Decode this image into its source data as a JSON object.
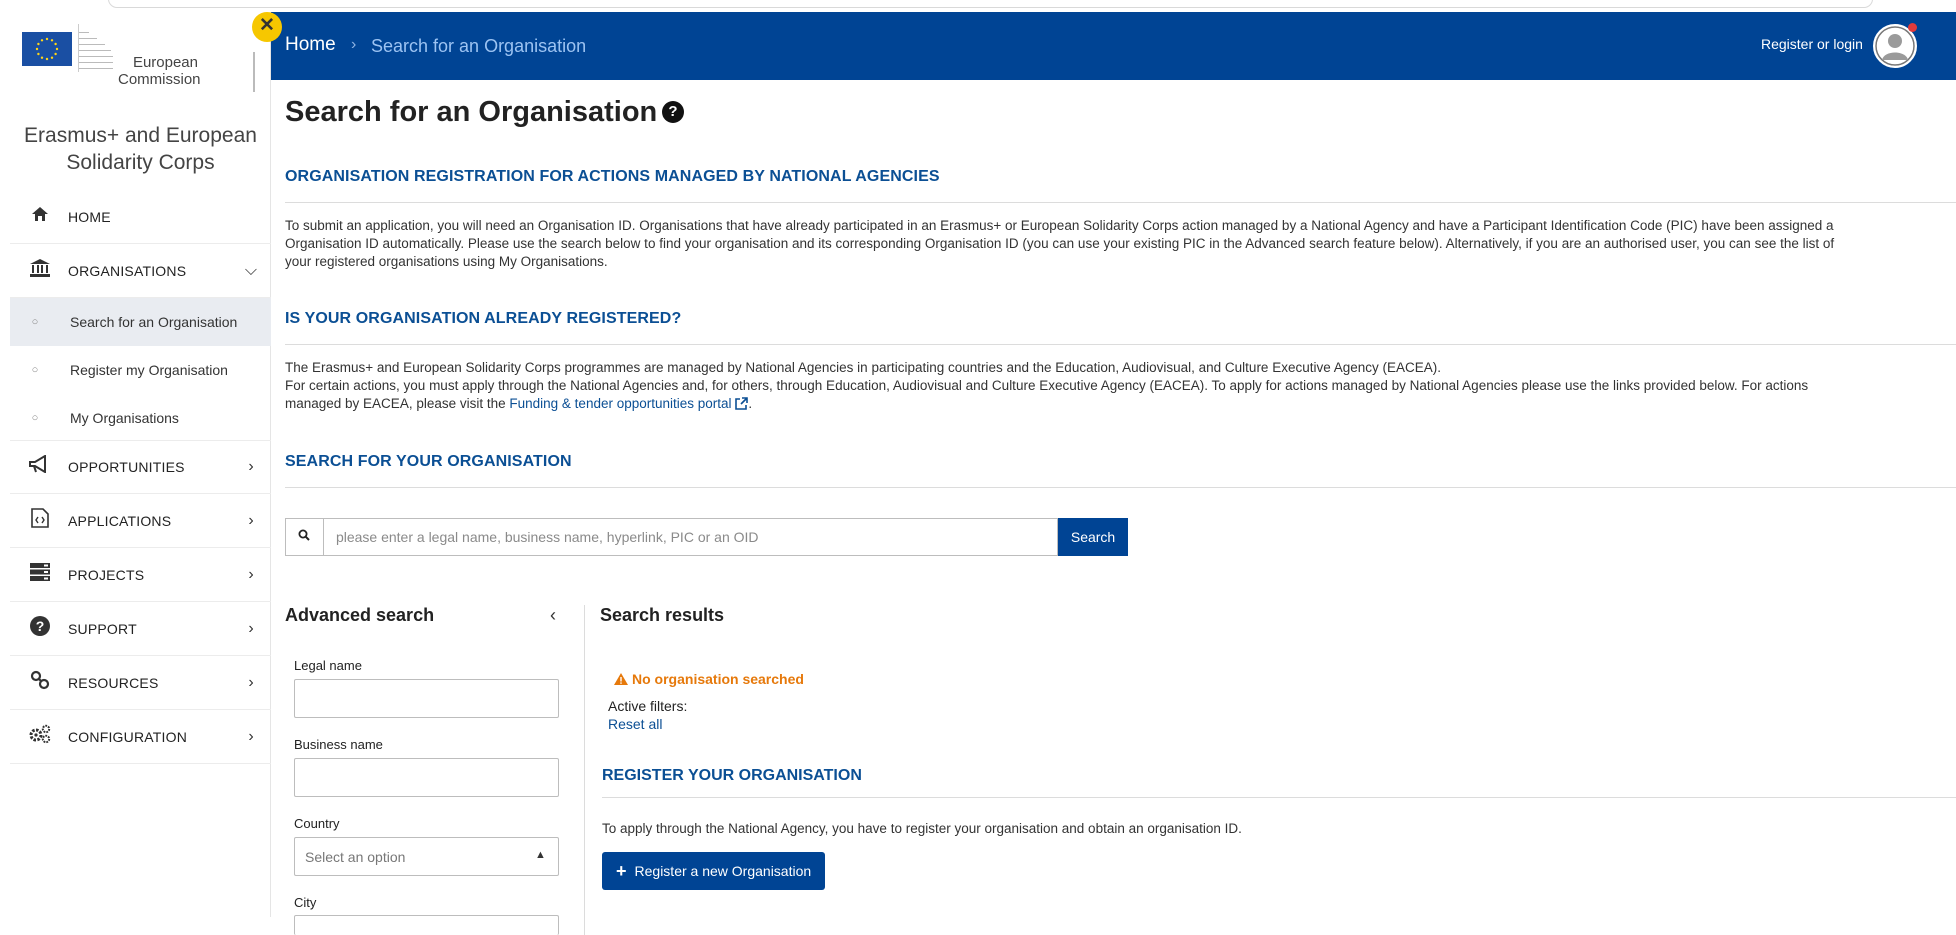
{
  "header": {
    "home": "Home",
    "separator": "›",
    "current": "Search for an Organisation",
    "login": "Register or login"
  },
  "logo": {
    "line1": "European",
    "line2": "Commission"
  },
  "brand": {
    "line1": "Erasmus+ and European",
    "line2": "Solidarity Corps"
  },
  "sidebar": {
    "items": [
      {
        "label": "HOME",
        "icon": "home-icon"
      },
      {
        "label": "ORGANISATIONS",
        "icon": "institution-icon"
      },
      {
        "label": "OPPORTUNITIES",
        "icon": "megaphone-icon"
      },
      {
        "label": "APPLICATIONS",
        "icon": "file-code-icon"
      },
      {
        "label": "PROJECTS",
        "icon": "server-icon"
      },
      {
        "label": "SUPPORT",
        "icon": "question-circle-icon"
      },
      {
        "label": "RESOURCES",
        "icon": "link-icon"
      },
      {
        "label": "CONFIGURATION",
        "icon": "cogs-icon"
      }
    ],
    "sub_items": [
      {
        "label": "Search for an Organisation"
      },
      {
        "label": "Register my Organisation"
      },
      {
        "label": "My Organisations"
      }
    ]
  },
  "main": {
    "title": "Search for an Organisation",
    "section1_title": "ORGANISATION REGISTRATION FOR ACTIONS MANAGED BY NATIONAL AGENCIES",
    "section1_line1": "To submit an application, you will need an Organisation ID. Organisations that have already participated in an Erasmus+ or European Solidarity Corps action managed by a National Agency and have a Participant Identification Code (PIC) have been assigned a",
    "section1_line2": "Organisation ID automatically. Please use the search below to find your organisation and its corresponding Organisation ID (you can use your existing PIC in the Advanced search feature below). Alternatively, if you are an authorised user, you can see the list of",
    "section1_line3": "your registered organisations using My Organisations.",
    "section2_title": "IS YOUR ORGANISATION ALREADY REGISTERED?",
    "section2_line1": "The Erasmus+ and European Solidarity Corps programmes are managed by National Agencies in participating countries and the Education, Audiovisual, and Culture Executive Agency (EACEA).",
    "section2_line2": "For certain actions, you must apply through the National Agencies and, for others, through Education, Audiovisual and Culture Executive Agency (EACEA). To apply for actions managed by National Agencies please use the links provided below. For actions",
    "section2_line3_pre": "managed by EACEA, please visit the",
    "section2_link": "Funding & tender opportunities portal",
    "section2_line3_post": ".",
    "section3_title": "SEARCH FOR YOUR ORGANISATION"
  },
  "search": {
    "placeholder": "please enter a legal name, business name, hyperlink, PIC or an OID",
    "button": "Search"
  },
  "advanced": {
    "title": "Advanced search",
    "collapse": "‹",
    "legal_name_label": "Legal name",
    "business_name_label": "Business name",
    "country_label": "Country",
    "country_placeholder": "Select an option",
    "city_label": "City"
  },
  "results": {
    "title": "Search results",
    "warning": "No organisation searched",
    "active_filters": "Active filters:",
    "reset": "Reset all",
    "register_title": "REGISTER YOUR ORGANISATION",
    "register_text": "To apply through the National Agency, you have to register your organisation and obtain an organisation ID.",
    "register_button": "Register a new Organisation"
  },
  "colors": {
    "topbar": "#004494",
    "link": "#0b4f94",
    "warning": "#e6790b",
    "close_badge": "#f6c700"
  }
}
